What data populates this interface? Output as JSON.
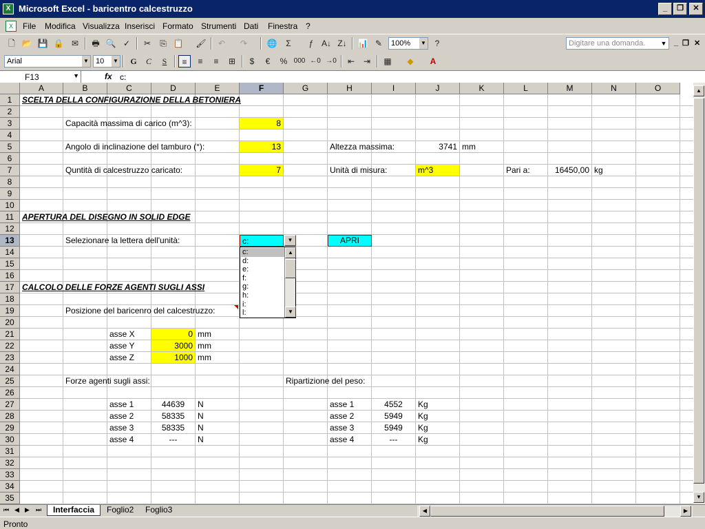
{
  "window": {
    "title": "Microsoft Excel - baricentro calcestruzzo"
  },
  "menu": [
    "File",
    "Modifica",
    "Visualizza",
    "Inserisci",
    "Formato",
    "Strumenti",
    "Dati",
    "Finestra",
    "?"
  ],
  "help_placeholder": "Digitare una domanda.",
  "toolbar": {
    "zoom": "100%",
    "font": "Arial",
    "size": "10",
    "bold": "G",
    "italic": "C",
    "underline": "S",
    "currency": "€",
    "percent": "%",
    "thousands": "000"
  },
  "formula": {
    "namebox": "F13",
    "fx": "fx",
    "value": "c:"
  },
  "columns": [
    "A",
    "B",
    "C",
    "D",
    "E",
    "F",
    "G",
    "H",
    "I",
    "J",
    "K",
    "L",
    "M",
    "N",
    "O"
  ],
  "rows": [
    "1",
    "2",
    "3",
    "4",
    "5",
    "6",
    "7",
    "8",
    "9",
    "10",
    "11",
    "12",
    "13",
    "14",
    "15",
    "16",
    "17",
    "18",
    "19",
    "20",
    "21",
    "22",
    "23",
    "24",
    "25",
    "26",
    "27",
    "28",
    "29",
    "30",
    "31",
    "32",
    "33",
    "34",
    "35"
  ],
  "sheet": {
    "h1": "SCELTA DELLA CONFIGURAZIONE DELLA BETONIERA",
    "cap_label": "Capacità massima di carico (m^3):",
    "cap_val": "8",
    "ang_label": "Angolo di inclinazione del tamburo (°):",
    "ang_val": "13",
    "alt_label": "Altezza massima:",
    "alt_val": "3741",
    "alt_unit": "mm",
    "qty_label": "Quntità di calcestruzzo caricato:",
    "qty_val": "7",
    "um_label": "Unità di misura:",
    "um_val": "m^3",
    "pari_label": "Pari a:",
    "pari_val": "16450,00",
    "pari_unit": "kg",
    "h2": "APERTURA DEL DISEGNO IN SOLID EDGE",
    "sel_label": "Selezionare la lettera dell'unità:",
    "sel_val": "c:",
    "apri": "APRI",
    "h3": "CALCOLO DELLE FORZE AGENTI SUGLI ASSI",
    "pos_label": "Posizione del baricenro del calcestruzzo:",
    "ax_x": "asse X",
    "val_x": "0",
    "ax_y": "asse Y",
    "val_y": "3000",
    "ax_z": "asse Z",
    "val_z": "1000",
    "mm": "mm",
    "forze_label": "Forze agenti sugli assi:",
    "rip_label": "Ripartizione del peso:",
    "forze": [
      {
        "asse": "asse 1",
        "val": "44639",
        "unit": "N"
      },
      {
        "asse": "asse 2",
        "val": "58335",
        "unit": "N"
      },
      {
        "asse": "asse 3",
        "val": "58335",
        "unit": "N"
      },
      {
        "asse": "asse 4",
        "val": "---",
        "unit": "N"
      }
    ],
    "pesi": [
      {
        "asse": "asse 1",
        "val": "4552",
        "unit": "Kg"
      },
      {
        "asse": "asse 2",
        "val": "5949",
        "unit": "Kg"
      },
      {
        "asse": "asse 3",
        "val": "5949",
        "unit": "Kg"
      },
      {
        "asse": "asse 4",
        "val": "---",
        "unit": "Kg"
      }
    ]
  },
  "dropdown_items": [
    "c:",
    "d:",
    "e:",
    "f:",
    "g:",
    "h:",
    "i:",
    "l:"
  ],
  "tabs": [
    "Interfaccia",
    "Foglio2",
    "Foglio3"
  ],
  "status": "Pronto"
}
